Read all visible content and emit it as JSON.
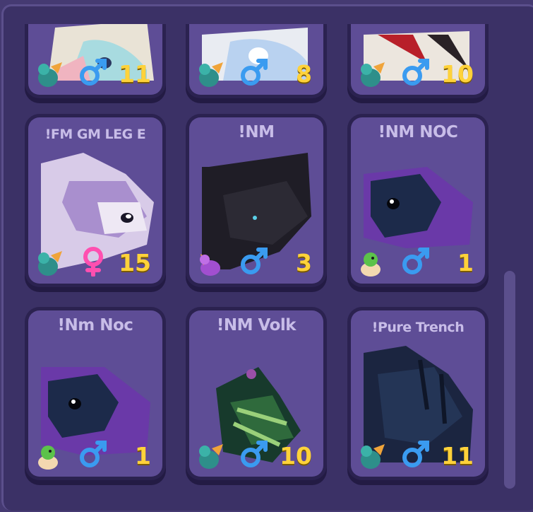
{
  "pets": [
    {
      "title": "",
      "count": "11",
      "pet_icon": "dragon-icon",
      "gender": "male-icon"
    },
    {
      "title": "",
      "count": "8",
      "pet_icon": "dragon-icon",
      "gender": "male-icon"
    },
    {
      "title": "",
      "count": "10",
      "pet_icon": "dragon-icon",
      "gender": "male-icon"
    },
    {
      "title": "!FM GM LEG E",
      "count": "15",
      "pet_icon": "dragon-icon",
      "gender": "female-icon"
    },
    {
      "title": "!NM",
      "count": "3",
      "pet_icon": "purple-dragon-icon",
      "gender": "male-icon"
    },
    {
      "title": "!NM NOC",
      "count": "1",
      "pet_icon": "egg-dragon-icon",
      "gender": "male-icon"
    },
    {
      "title": "!Nm Noc",
      "count": "1",
      "pet_icon": "egg-dragon-icon",
      "gender": "male-icon"
    },
    {
      "title": "!NM Volk",
      "count": "10",
      "pet_icon": "dragon-icon",
      "gender": "male-icon"
    },
    {
      "title": "!Pure Trench",
      "count": "11",
      "pet_icon": "dragon-icon",
      "gender": "male-icon"
    }
  ],
  "colors": {
    "card": "#5e4d96",
    "count": "#ffd23a",
    "male": "#3a9bf0",
    "female": "#ff4fb0"
  }
}
